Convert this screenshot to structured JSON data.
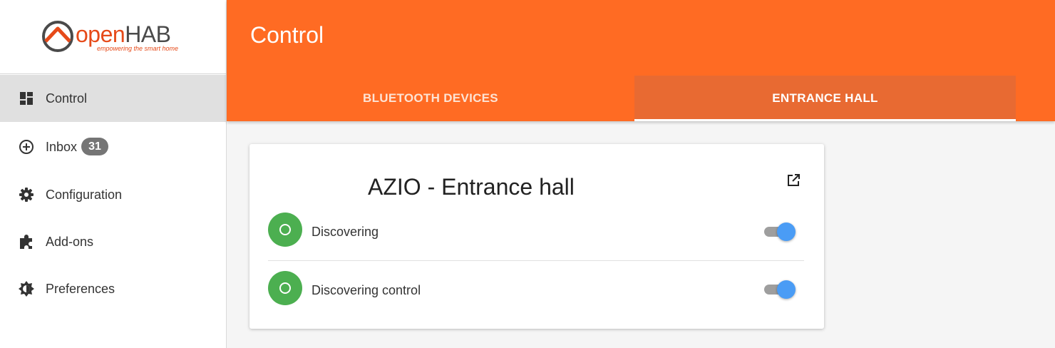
{
  "logo": {
    "text_open": "open",
    "text_hab": "HAB",
    "tagline": "empowering the smart home"
  },
  "sidebar": {
    "items": [
      {
        "label": "Control",
        "icon": "dashboard-icon",
        "active": true
      },
      {
        "label": "Inbox",
        "icon": "add-circle-icon",
        "badge": "31"
      },
      {
        "label": "Configuration",
        "icon": "gear-icon"
      },
      {
        "label": "Add-ons",
        "icon": "puzzle-icon"
      },
      {
        "label": "Preferences",
        "icon": "brightness-icon"
      }
    ]
  },
  "header": {
    "title": "Control",
    "tabs": [
      {
        "label": "BLUETOOTH DEVICES",
        "active": false
      },
      {
        "label": "ENTRANCE HALL",
        "active": true
      }
    ]
  },
  "card": {
    "title": "AZIO - Entrance hall",
    "rows": [
      {
        "label": "Discovering",
        "on": true
      },
      {
        "label": "Discovering control",
        "on": true
      }
    ]
  },
  "colors": {
    "accent": "#ff6b23",
    "active_tab": "#e86a32",
    "status_green": "#4caf50",
    "toggle_blue": "#4a9cf5"
  }
}
